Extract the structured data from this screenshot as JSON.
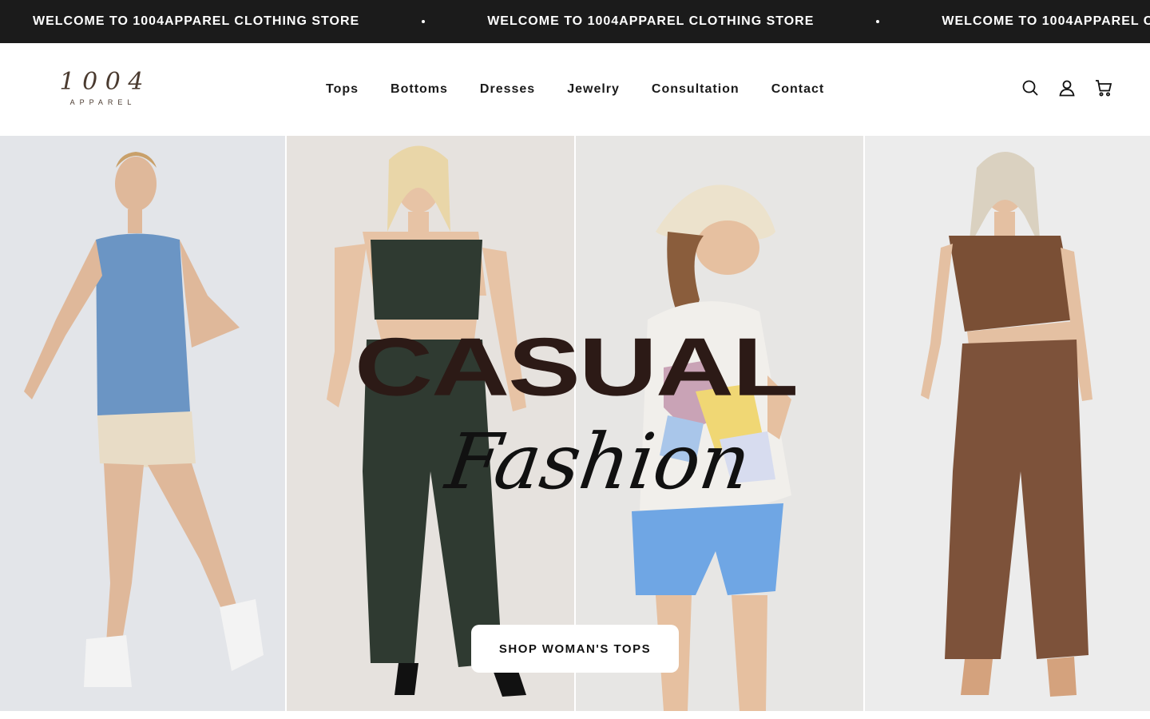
{
  "announcement": {
    "items": [
      "WELCOME TO 1004APPAREL CLOTHING STORE",
      "WELCOME TO 1004APPAREL CLOTHING STORE",
      "WELCOME TO 1004APPAREL CLOTHING STORE"
    ]
  },
  "logo": {
    "wordmark": "1 0 0 4",
    "subtitle": "APPAREL"
  },
  "nav": {
    "items": [
      "Tops",
      "Bottoms",
      "Dresses",
      "Jewelry",
      "Consultation",
      "Contact"
    ]
  },
  "header_icons": [
    "search-icon",
    "account-icon",
    "cart-icon"
  ],
  "hero": {
    "title": "CASUAL",
    "script_title": "Fashion",
    "cta_label": "SHOP WOMAN'S TOPS",
    "panels": [
      "model-blue-top",
      "model-green-set",
      "model-bucket-hat",
      "model-brown-set"
    ]
  },
  "colors": {
    "announcement_bg": "#1b1b1b",
    "title": "#2c1a16",
    "logo": "#4a3a2f"
  }
}
